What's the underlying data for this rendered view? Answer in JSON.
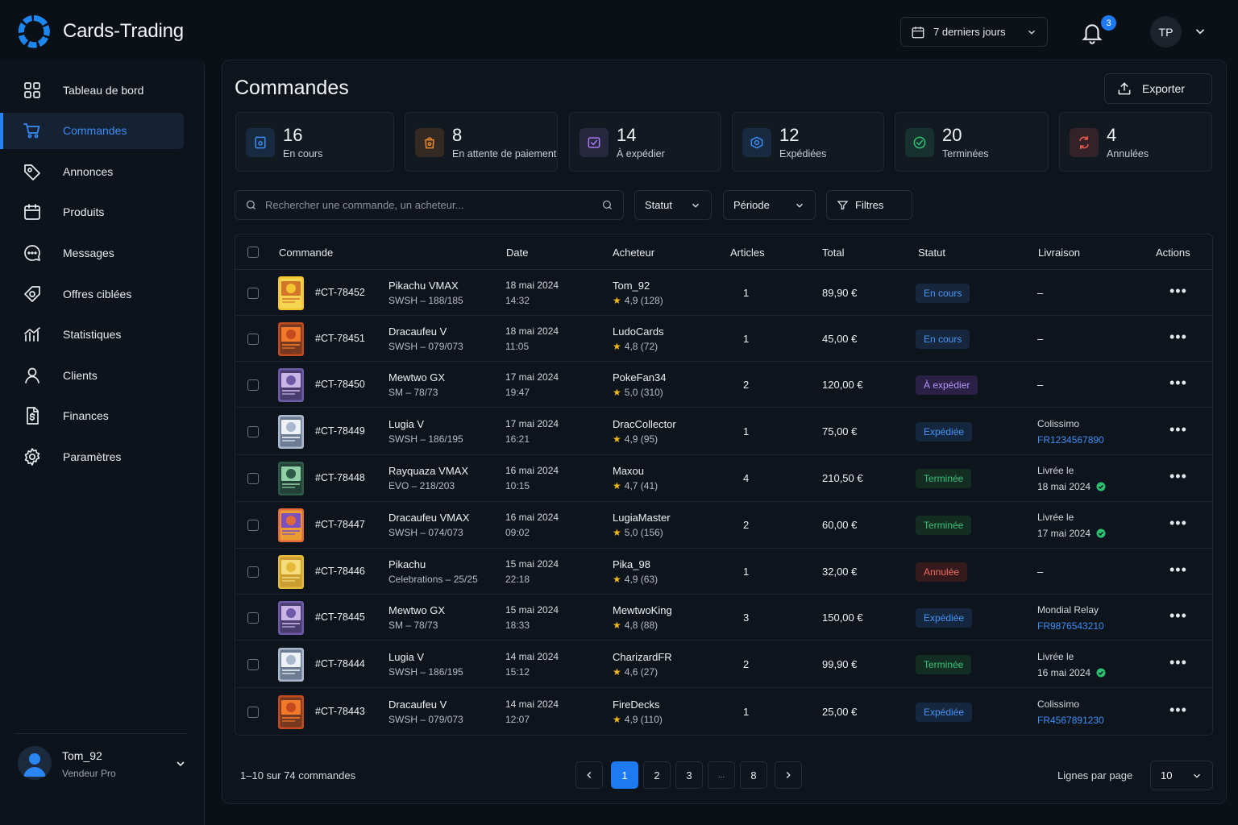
{
  "app": {
    "title": "Cards-Trading"
  },
  "topbar": {
    "period": "7 derniers jours",
    "notifications_count": "3",
    "user_initials": "TP"
  },
  "sidebar": {
    "items": [
      {
        "label": "Tableau de bord",
        "icon": "grid-icon",
        "active": false
      },
      {
        "label": "Commandes",
        "icon": "cart-icon",
        "active": true
      },
      {
        "label": "Annonces",
        "icon": "tag-icon",
        "active": false
      },
      {
        "label": "Produits",
        "icon": "calendar-box-icon",
        "active": false
      },
      {
        "label": "Messages",
        "icon": "chat-icon",
        "active": false
      },
      {
        "label": "Offres ciblées",
        "icon": "target-tag-icon",
        "active": false
      },
      {
        "label": "Statistiques",
        "icon": "chart-icon",
        "active": false
      },
      {
        "label": "Clients",
        "icon": "user-icon",
        "active": false
      },
      {
        "label": "Finances",
        "icon": "document-dollar-icon",
        "active": false
      },
      {
        "label": "Paramètres",
        "icon": "gear-icon",
        "active": false
      }
    ],
    "user": {
      "name": "Tom_92",
      "role": "Vendeur Pro"
    }
  },
  "main": {
    "title": "Commandes",
    "export_label": "Exporter",
    "stats": [
      {
        "value": "16",
        "label": "En cours",
        "color": "#3b8cf2"
      },
      {
        "value": "8",
        "label": "En attente de paiement",
        "color": "#f08a2c"
      },
      {
        "value": "14",
        "label": "À expédier",
        "color": "#a77cf0"
      },
      {
        "value": "12",
        "label": "Expédiées",
        "color": "#3b8cf2"
      },
      {
        "value": "20",
        "label": "Terminées",
        "color": "#35c276"
      },
      {
        "value": "4",
        "label": "Annulées",
        "color": "#ef5b4f"
      }
    ],
    "search_placeholder": "Rechercher une commande, un acheteur...",
    "filters": {
      "status": "Statut",
      "period": "Période",
      "more": "Filtres"
    },
    "table": {
      "columns": [
        "Commande",
        "Date",
        "Acheteur",
        "Articles",
        "Total",
        "Statut",
        "Livraison",
        "Actions"
      ],
      "rows": [
        {
          "id": "#CT-78452",
          "card": "Pikachu VMAX",
          "set": "SWSH – 188/185",
          "date": "18 mai 2024",
          "time": "14:32",
          "buyer": "Tom_92",
          "rating": "4,9 (128)",
          "articles": "1",
          "total": "89,90 €",
          "status": "En cours",
          "status_key": "encours",
          "ship1": "–",
          "ship2": "",
          "ship_kind": "none",
          "thumb": "yellow"
        },
        {
          "id": "#CT-78451",
          "card": "Dracaufeu V",
          "set": "SWSH – 079/073",
          "date": "18 mai 2024",
          "time": "11:05",
          "buyer": "LudoCards",
          "rating": "4,8 (72)",
          "articles": "1",
          "total": "45,00 €",
          "status": "En cours",
          "status_key": "encours",
          "ship1": "–",
          "ship2": "",
          "ship_kind": "none",
          "thumb": "orange"
        },
        {
          "id": "#CT-78450",
          "card": "Mewtwo GX",
          "set": "SM – 78/73",
          "date": "17 mai 2024",
          "time": "19:47",
          "buyer": "PokeFan34",
          "rating": "5,0 (310)",
          "articles": "2",
          "total": "120,00 €",
          "status": "À expédier",
          "status_key": "expedier",
          "ship1": "–",
          "ship2": "",
          "ship_kind": "none",
          "thumb": "purple"
        },
        {
          "id": "#CT-78449",
          "card": "Lugia V",
          "set": "SWSH – 186/195",
          "date": "17 mai 2024",
          "time": "16:21",
          "buyer": "DracCollector",
          "rating": "4,9 (95)",
          "articles": "1",
          "total": "75,00 €",
          "status": "Expédiée",
          "status_key": "expediee",
          "ship1": "Colissimo",
          "ship2": "FR1234567890",
          "ship_kind": "track",
          "thumb": "silver"
        },
        {
          "id": "#CT-78448",
          "card": "Rayquaza VMAX",
          "set": "EVO – 218/203",
          "date": "16 mai 2024",
          "time": "10:15",
          "buyer": "Maxou",
          "rating": "4,7 (41)",
          "articles": "4",
          "total": "210,50 €",
          "status": "Terminée",
          "status_key": "terminee",
          "ship1": "Livrée le",
          "ship2": "18 mai 2024",
          "ship_kind": "done",
          "thumb": "green"
        },
        {
          "id": "#CT-78447",
          "card": "Dracaufeu VMAX",
          "set": "SWSH – 074/073",
          "date": "16 mai 2024",
          "time": "09:02",
          "buyer": "LugiaMaster",
          "rating": "5,0 (156)",
          "articles": "2",
          "total": "60,00 €",
          "status": "Terminée",
          "status_key": "terminee",
          "ship1": "Livrée le",
          "ship2": "17 mai 2024",
          "ship_kind": "done",
          "thumb": "rainbow"
        },
        {
          "id": "#CT-78446",
          "card": "Pikachu",
          "set": "Celebrations – 25/25",
          "date": "15 mai 2024",
          "time": "22:18",
          "buyer": "Pika_98",
          "rating": "4,9 (63)",
          "articles": "1",
          "total": "32,00 €",
          "status": "Annulée",
          "status_key": "annulee",
          "ship1": "–",
          "ship2": "",
          "ship_kind": "none",
          "thumb": "gold"
        },
        {
          "id": "#CT-78445",
          "card": "Mewtwo GX",
          "set": "SM – 78/73",
          "date": "15 mai 2024",
          "time": "18:33",
          "buyer": "MewtwoKing",
          "rating": "4,8 (88)",
          "articles": "3",
          "total": "150,00 €",
          "status": "Expédiée",
          "status_key": "expediee",
          "ship1": "Mondial Relay",
          "ship2": "FR9876543210",
          "ship_kind": "track",
          "thumb": "purple"
        },
        {
          "id": "#CT-78444",
          "card": "Lugia V",
          "set": "SWSH – 186/195",
          "date": "14 mai 2024",
          "time": "15:12",
          "buyer": "CharizardFR",
          "rating": "4,6 (27)",
          "articles": "2",
          "total": "99,90 €",
          "status": "Terminée",
          "status_key": "terminee",
          "ship1": "Livrée le",
          "ship2": "16 mai 2024",
          "ship_kind": "done",
          "thumb": "silver"
        },
        {
          "id": "#CT-78443",
          "card": "Dracaufeu V",
          "set": "SWSH – 079/073",
          "date": "14 mai 2024",
          "time": "12:07",
          "buyer": "FireDecks",
          "rating": "4,9 (110)",
          "articles": "1",
          "total": "25,00 €",
          "status": "Expédiée",
          "status_key": "expediee",
          "ship1": "Colissimo",
          "ship2": "FR4567891230",
          "ship_kind": "track",
          "thumb": "orange"
        }
      ]
    },
    "pagination": {
      "info": "1–10 sur 74 commandes",
      "pages": [
        "1",
        "2",
        "3",
        "...",
        "8"
      ],
      "current": "1",
      "rows_label": "Lignes par page",
      "rows_value": "10"
    }
  }
}
